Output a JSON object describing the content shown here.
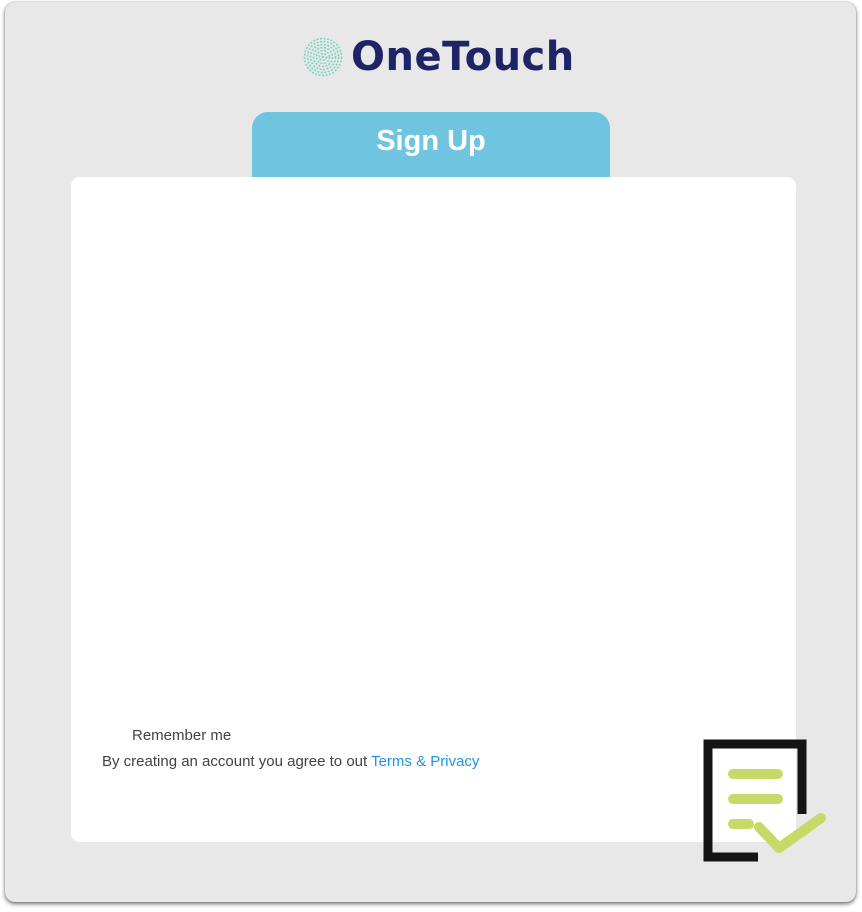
{
  "app": {
    "brand_name": "OneTouch",
    "logo_icon": "fingerprint-icon",
    "accent_color": "#6fc4df",
    "brand_color": "#1f2466",
    "fingerprint_color": "#7fd4bd"
  },
  "signup": {
    "tab_label": "Sign Up",
    "remember_label": "Remember me",
    "agree_text": "By creating an account you agree to out ",
    "terms_link": "Terms & Privacy",
    "link_color": "#2193e6"
  },
  "decoration": {
    "icon": "checklist-icon",
    "line_color": "#c7d966",
    "frame_color": "#141414"
  }
}
